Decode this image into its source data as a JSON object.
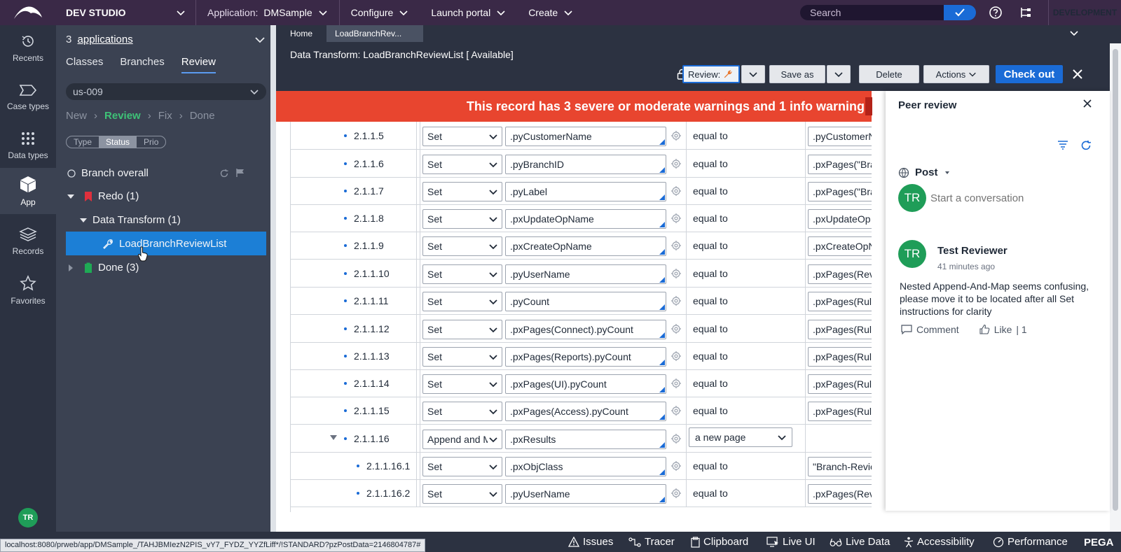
{
  "topbar": {
    "studio": "DEV STUDIO",
    "application_label": "Application:",
    "application_value": "DMSample",
    "configure": "Configure",
    "launch_portal": "Launch portal",
    "create": "Create",
    "search_placeholder": "Search",
    "environment": "DEVELOPMENT"
  },
  "leftnav": {
    "items": [
      {
        "label": "Recents",
        "icon": "clock-history-icon"
      },
      {
        "label": "Case types",
        "icon": "case-tag-icon"
      },
      {
        "label": "Data types",
        "icon": "dots-grid-icon"
      },
      {
        "label": "App",
        "icon": "cube-icon"
      },
      {
        "label": "Records",
        "icon": "layers-icon"
      },
      {
        "label": "Favorites",
        "icon": "star-icon"
      }
    ],
    "user_initials": "TR"
  },
  "explorer": {
    "app_count": "3",
    "apps_link": "applications",
    "tabs": [
      "Classes",
      "Branches",
      "Review"
    ],
    "branch": "us-009",
    "steps": [
      "New",
      "Review",
      "Fix",
      "Done"
    ],
    "filters": [
      "Type",
      "Status",
      "Prio"
    ],
    "branch_overall": "Branch overall",
    "redo": "Redo (1)",
    "data_transform": "Data Transform (1)",
    "selected_rule": "LoadBranchReviewList",
    "done": "Done (3)"
  },
  "doc_tabs": [
    "Home",
    "LoadBranchRev..."
  ],
  "rule": {
    "title": "Data Transform: LoadBranchReviewList  [ Available]",
    "review_btn": "Review:",
    "save_as": "Save as",
    "delete": "Delete",
    "actions": "Actions",
    "check_out": "Check out"
  },
  "warning": "This record has 3 severe or moderate warnings and 1 info warning",
  "rows": [
    {
      "step": "2.1.1.5",
      "action": "Set",
      "target": ".pyCustomerName",
      "relation": "equal to",
      "source": ".pyCustomerN"
    },
    {
      "step": "2.1.1.6",
      "action": "Set",
      "target": ".pyBranchID",
      "relation": "equal to",
      "source": ".pxPages(\"Bra"
    },
    {
      "step": "2.1.1.7",
      "action": "Set",
      "target": ".pyLabel",
      "relation": "equal to",
      "source": ".pxPages(\"Bra"
    },
    {
      "step": "2.1.1.8",
      "action": "Set",
      "target": ".pxUpdateOpName",
      "relation": "equal to",
      "source": ".pxUpdateOp"
    },
    {
      "step": "2.1.1.9",
      "action": "Set",
      "target": ".pxCreateOpName",
      "relation": "equal to",
      "source": ".pxCreateOpN"
    },
    {
      "step": "2.1.1.10",
      "action": "Set",
      "target": ".pyUserName",
      "relation": "equal to",
      "source": ".pxPages(Rev"
    },
    {
      "step": "2.1.1.11",
      "action": "Set",
      "target": ".pyCount",
      "relation": "equal to",
      "source": ".pxPages(Rule"
    },
    {
      "step": "2.1.1.12",
      "action": "Set",
      "target": ".pxPages(Connect).pyCount",
      "relation": "equal to",
      "source": ".pxPages(Rule"
    },
    {
      "step": "2.1.1.13",
      "action": "Set",
      "target": ".pxPages(Reports).pyCount",
      "relation": "equal to",
      "source": ".pxPages(Rule"
    },
    {
      "step": "2.1.1.14",
      "action": "Set",
      "target": ".pxPages(UI).pyCount",
      "relation": "equal to",
      "source": ".pxPages(Rule"
    },
    {
      "step": "2.1.1.15",
      "action": "Set",
      "target": ".pxPages(Access).pyCount",
      "relation": "equal to",
      "source": ".pxPages(Rule"
    },
    {
      "step": "2.1.1.16",
      "action": "Append and M",
      "target": ".pxResults",
      "relation": "a new page",
      "source": ""
    },
    {
      "step": "2.1.1.16.1",
      "action": "Set",
      "target": ".pxObjClass",
      "relation": "equal to",
      "source": "\"Branch-Revie"
    },
    {
      "step": "2.1.1.16.2",
      "action": "Set",
      "target": ".pyUserName",
      "relation": "equal to",
      "source": ".pxPages(Rev"
    }
  ],
  "peer": {
    "title": "Peer review",
    "post": "Post",
    "user_initials": "TR",
    "placeholder": "Start a conversation",
    "reviewer_initials": "TR",
    "reviewer": "Test Reviewer",
    "time": "41 minutes ago",
    "comment": "Nested Append-And-Map seems confusing, please move it to be located after all Set instructions for clarity",
    "comment_action": "Comment",
    "like": "Like",
    "like_count": "| 1"
  },
  "statusbar": {
    "url": "localhost:8080/prweb/app/DMSample_/TAHJBMIezN2PIS_vY7_FYDZ_YYZfLiff*/!STANDARD?pzPostData=2146804787#",
    "items": [
      "Issues",
      "Tracer",
      "Clipboard",
      "Live UI",
      "Live Data",
      "Accessibility",
      "Performance"
    ],
    "brand": "PEGA"
  }
}
